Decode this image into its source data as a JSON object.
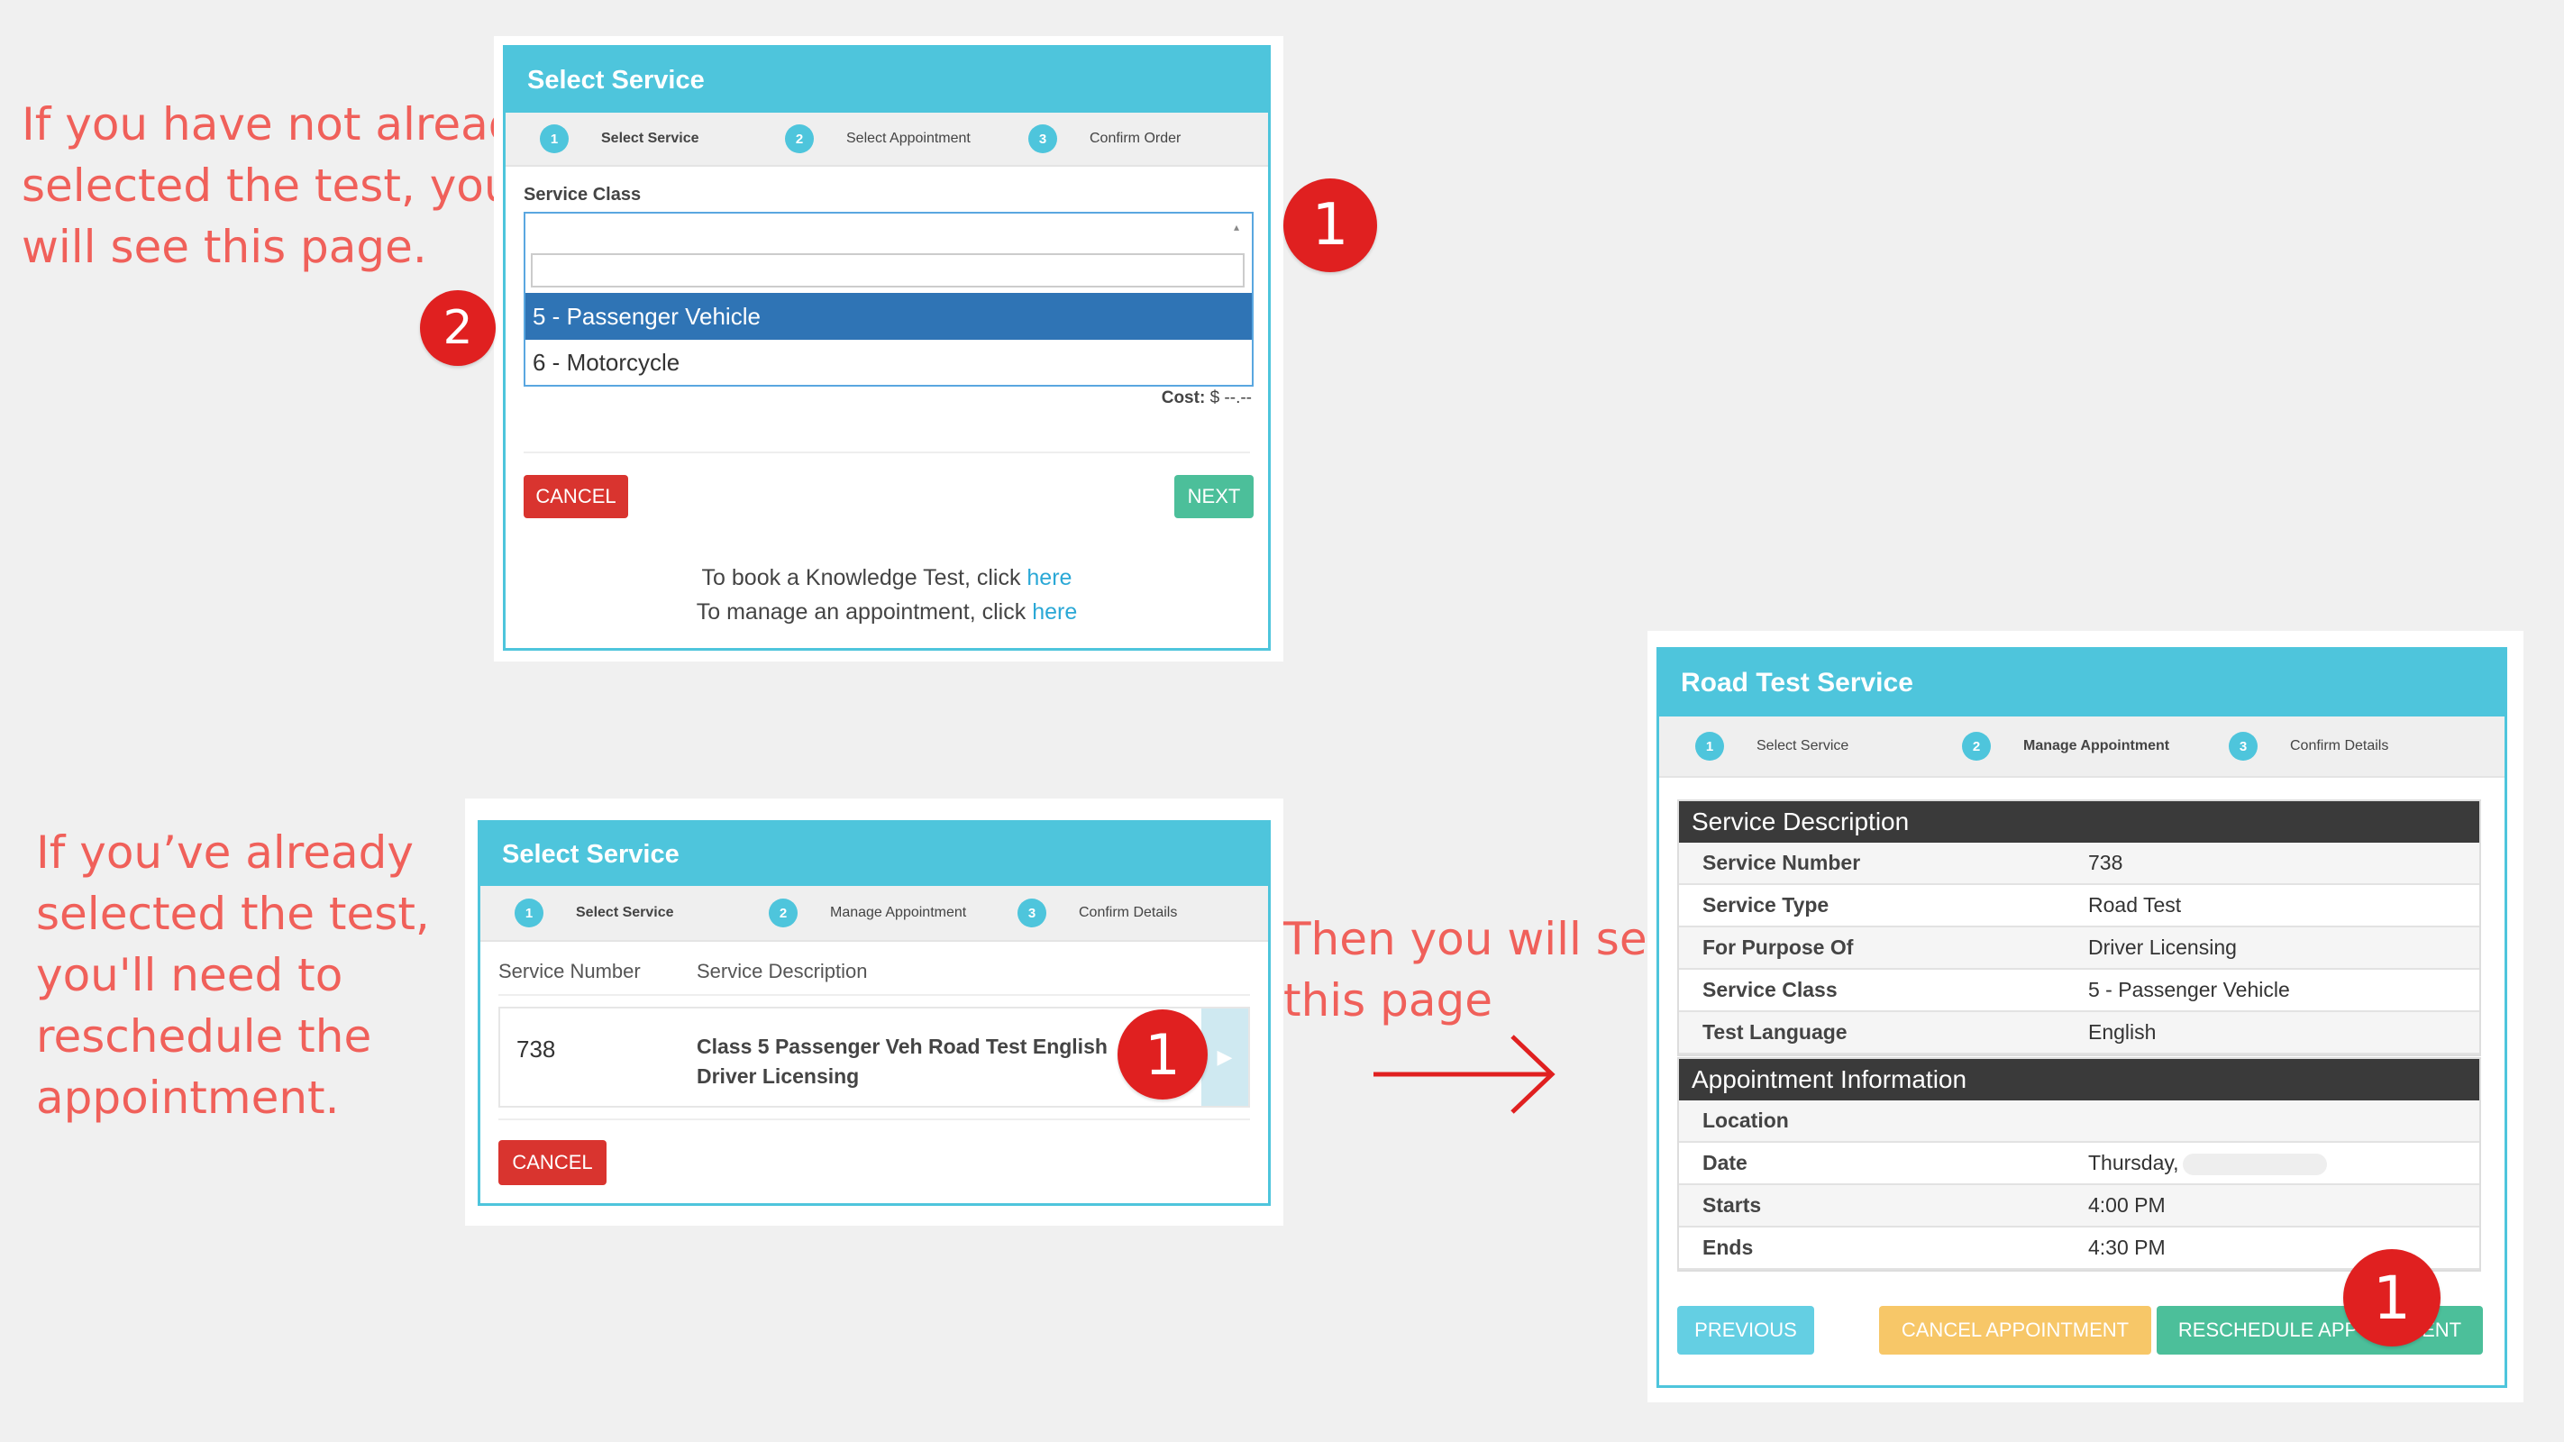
{
  "annotations": {
    "top_left": "If you have not already\nselected the test, you\nwill see this page.",
    "bottom_left": "If you’ve already\nselected the test,\nyou'll need to\nreschedule the\nappointment.",
    "middle": "Then you will see\nthis page"
  },
  "badges": {
    "one": "1",
    "two": "2"
  },
  "colors": {
    "header": "#4ec5dc",
    "cancel": "#d9342f",
    "next": "#4cbf9a",
    "selected_option": "#2f74b5",
    "annotation": "#f0605a",
    "badge": "#e02020"
  },
  "panel1": {
    "title": "Select Service",
    "steps": [
      {
        "num": "1",
        "label": "Select Service"
      },
      {
        "num": "2",
        "label": "Select Appointment"
      },
      {
        "num": "3",
        "label": "Confirm Order"
      }
    ],
    "field_label": "Service Class",
    "dropdown_options": [
      "5 - Passenger Vehicle",
      "6 - Motorcycle"
    ],
    "cost_label": "Cost:",
    "cost_value": "$ --.--",
    "cancel_label": "CANCEL",
    "next_label": "NEXT",
    "knowledge_text": "To book a Knowledge Test, click",
    "manage_text": "To manage an appointment, click",
    "link_text": "here"
  },
  "panel2": {
    "title": "Select Service",
    "steps": [
      {
        "num": "1",
        "label": "Select Service"
      },
      {
        "num": "2",
        "label": "Manage Appointment"
      },
      {
        "num": "3",
        "label": "Confirm Details"
      }
    ],
    "col_number": "Service Number",
    "col_description": "Service Description",
    "row_number": "738",
    "row_description_line1": "Class 5 Passenger Veh Road Test English",
    "row_description_line2": "Driver Licensing",
    "cancel_label": "CANCEL"
  },
  "panel3": {
    "title": "Road Test Service",
    "steps": [
      {
        "num": "1",
        "label": "Select Service"
      },
      {
        "num": "2",
        "label": "Manage Appointment"
      },
      {
        "num": "3",
        "label": "Confirm Details"
      }
    ],
    "service_heading": "Service Description",
    "service_rows": [
      {
        "label": "Service Number",
        "value": "738"
      },
      {
        "label": "Service Type",
        "value": "Road Test"
      },
      {
        "label": "For Purpose Of",
        "value": "Driver Licensing"
      },
      {
        "label": "Service Class",
        "value": "5 - Passenger Vehicle"
      },
      {
        "label": "Test Language",
        "value": "English"
      }
    ],
    "appointment_heading": "Appointment Information",
    "appointment_rows": [
      {
        "label": "Location",
        "value": ""
      },
      {
        "label": "Date",
        "value": "Thursday,"
      },
      {
        "label": "Starts",
        "value": "4:00 PM"
      },
      {
        "label": "Ends",
        "value": "4:30 PM"
      }
    ],
    "previous_label": "PREVIOUS",
    "cancel_appt_label": "CANCEL APPOINTMENT",
    "reschedule_label": "RESCHEDULE APPOINTMENT"
  }
}
